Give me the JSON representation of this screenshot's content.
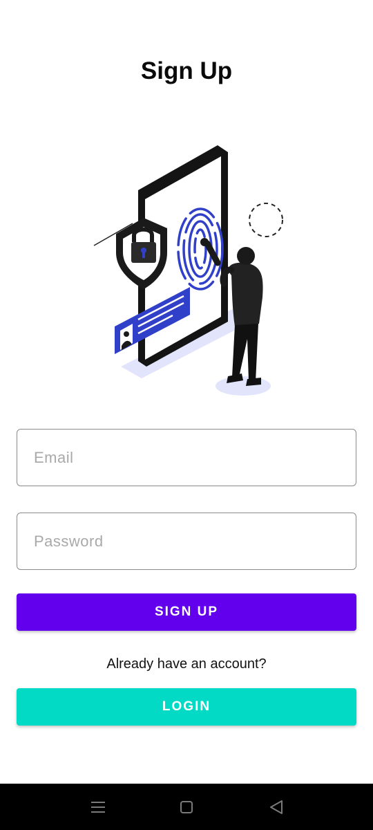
{
  "header": {
    "title": "Sign Up"
  },
  "form": {
    "email": {
      "value": "",
      "placeholder": "Email"
    },
    "password": {
      "value": "",
      "placeholder": "Password"
    }
  },
  "actions": {
    "signup_label": "SIGN UP",
    "account_prompt": "Already have an account?",
    "login_label": "LOGIN"
  },
  "colors": {
    "primary": "#6200ee",
    "secondary": "#03dac5",
    "illustration_accent": "#3140c9",
    "nav_background": "#000000"
  },
  "icons": {
    "illustration": "fingerprint-security-illustration",
    "nav_recents": "menu-lines-icon",
    "nav_home": "square-home-icon",
    "nav_back": "triangle-back-icon"
  }
}
